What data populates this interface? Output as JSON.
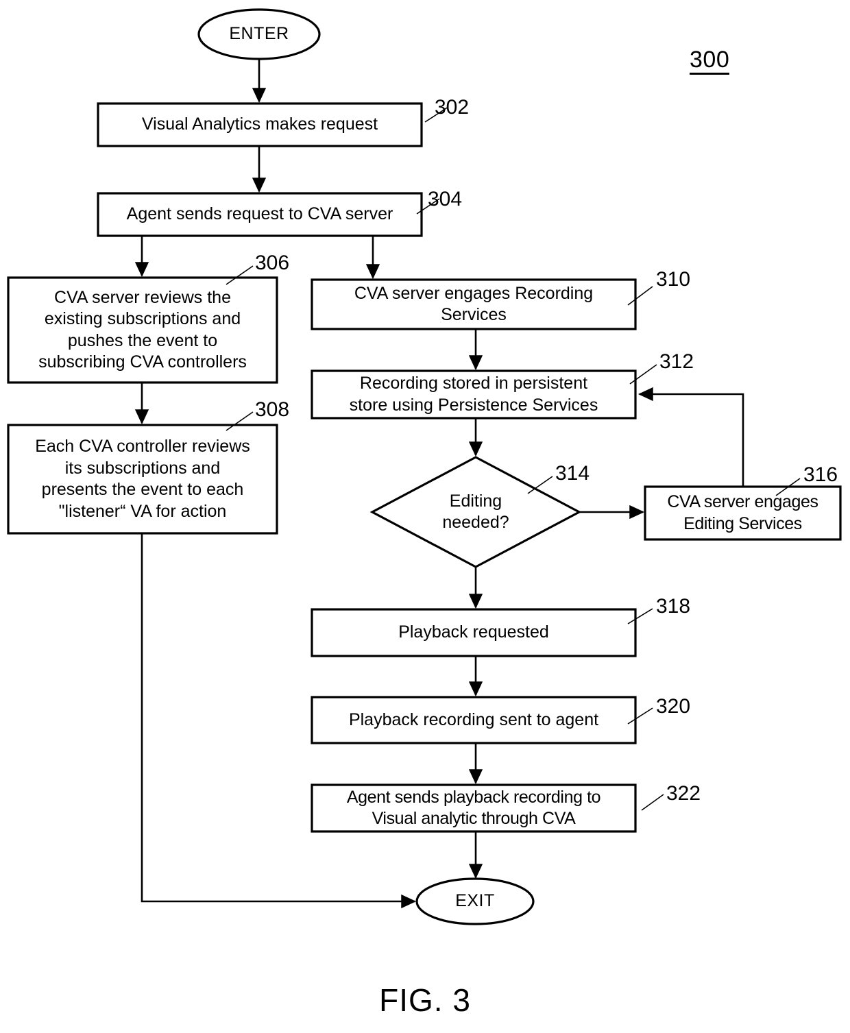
{
  "figure": {
    "id_label": "300",
    "caption": "FIG. 3",
    "type": "flowchart"
  },
  "colors": {
    "stroke": "#000000",
    "background": "#ffffff",
    "text": "#000000"
  },
  "nodes": {
    "enter": {
      "label": "ENTER",
      "shape": "ellipse"
    },
    "exit": {
      "label": "EXIT",
      "shape": "ellipse"
    },
    "n302": {
      "ref": "302",
      "shape": "process",
      "label": "Visual Analytics makes request"
    },
    "n304": {
      "ref": "304",
      "shape": "process",
      "label": "Agent sends request to CVA server"
    },
    "n306": {
      "ref": "306",
      "shape": "process",
      "label": "CVA server reviews the\nexisting subscriptions and\npushes the event to\nsubscribing CVA controllers"
    },
    "n308": {
      "ref": "308",
      "shape": "process",
      "label": "Each CVA controller reviews\nits subscriptions and\npresents the event to each\n\"listener“ VA for action"
    },
    "n310": {
      "ref": "310",
      "shape": "process",
      "label": "CVA server engages Recording\nServices"
    },
    "n312": {
      "ref": "312",
      "shape": "process",
      "label": "Recording stored in persistent\nstore using Persistence  Services"
    },
    "n314": {
      "ref": "314",
      "shape": "decision",
      "label": "Editing\nneeded?"
    },
    "n316": {
      "ref": "316",
      "shape": "process",
      "label": "CVA server engages\nEditing Services"
    },
    "n318": {
      "ref": "318",
      "shape": "process",
      "label": "Playback requested"
    },
    "n320": {
      "ref": "320",
      "shape": "process",
      "label": "Playback recording sent to agent"
    },
    "n322": {
      "ref": "322",
      "shape": "process",
      "label": "Agent sends playback recording to\nVisual analytic through CVA"
    }
  },
  "edges": [
    {
      "from": "enter",
      "to": "n302",
      "label": ""
    },
    {
      "from": "n302",
      "to": "n304",
      "label": ""
    },
    {
      "from": "n304",
      "to": "n306",
      "label": ""
    },
    {
      "from": "n304",
      "to": "n310",
      "label": ""
    },
    {
      "from": "n306",
      "to": "n308",
      "label": ""
    },
    {
      "from": "n308",
      "to": "exit",
      "label": ""
    },
    {
      "from": "n310",
      "to": "n312",
      "label": ""
    },
    {
      "from": "n312",
      "to": "n314",
      "label": ""
    },
    {
      "from": "n314",
      "to": "n316",
      "label": ""
    },
    {
      "from": "n316",
      "to": "n312",
      "label": ""
    },
    {
      "from": "n314",
      "to": "n318",
      "label": ""
    },
    {
      "from": "n318",
      "to": "n320",
      "label": ""
    },
    {
      "from": "n320",
      "to": "n322",
      "label": ""
    },
    {
      "from": "n322",
      "to": "exit",
      "label": ""
    }
  ]
}
